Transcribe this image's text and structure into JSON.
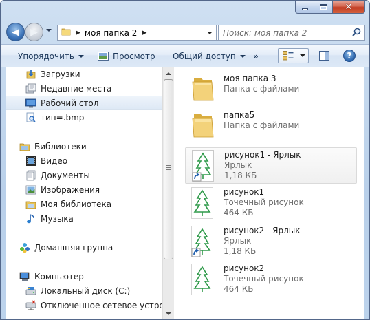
{
  "window": {
    "caption_min": "minimize",
    "caption_max": "maximize",
    "caption_close": "close"
  },
  "address": {
    "path": "моя папка 2"
  },
  "search": {
    "placeholder": "Поиск: моя папка 2"
  },
  "toolbar": {
    "organize": "Упорядочить",
    "preview": "Просмотр",
    "share": "Общий доступ",
    "more": "»",
    "help": "?"
  },
  "navpane": {
    "items": [
      {
        "label": "Загрузки",
        "icon": "downloads-icon"
      },
      {
        "label": "Недавние места",
        "icon": "recent-places-icon"
      },
      {
        "label": "Рабочий стол",
        "icon": "desktop-icon",
        "selected": true
      },
      {
        "label": "тип=.bmp",
        "icon": "saved-search-icon"
      },
      {
        "label": "Библиотеки",
        "icon": "libraries-icon"
      },
      {
        "label": "Видео",
        "icon": "video-icon"
      },
      {
        "label": "Документы",
        "icon": "documents-icon"
      },
      {
        "label": "Изображения",
        "icon": "pictures-icon"
      },
      {
        "label": "Моя библиотека",
        "icon": "library-icon"
      },
      {
        "label": "Музыка",
        "icon": "music-icon"
      },
      {
        "label": "Домашняя группа",
        "icon": "homegroup-icon"
      },
      {
        "label": "Компьютер",
        "icon": "computer-icon"
      },
      {
        "label": "Локальный диск (C:)",
        "icon": "local-disk-icon"
      },
      {
        "label": "Отключенное сетевое устройство",
        "icon": "network-drive-icon"
      }
    ]
  },
  "files": [
    {
      "name": "моя папка 3",
      "type": "Папка с файлами",
      "size": "",
      "icon": "folder-icon"
    },
    {
      "name": "папка5",
      "type": "Папка с файлами",
      "size": "",
      "icon": "folder-icon"
    },
    {
      "name": "рисунок1 - Ярлык",
      "type": "Ярлык",
      "size": "1,18 КБ",
      "icon": "bitmap-shortcut-icon"
    },
    {
      "name": "рисунок1",
      "type": "Точечный рисунок",
      "size": "464 КБ",
      "icon": "bitmap-icon"
    },
    {
      "name": "рисунок2 - Ярлык",
      "type": "Ярлык",
      "size": "1,18 КБ",
      "icon": "bitmap-shortcut-icon"
    },
    {
      "name": "рисунок2",
      "type": "Точечный рисунок",
      "size": "464 КБ",
      "icon": "bitmap-icon"
    }
  ],
  "colors": {
    "frame": "#bcd3ec",
    "toolbar_text": "#1e395b",
    "selection": "#dde8f5",
    "tree_green": "#2f9a4a"
  }
}
